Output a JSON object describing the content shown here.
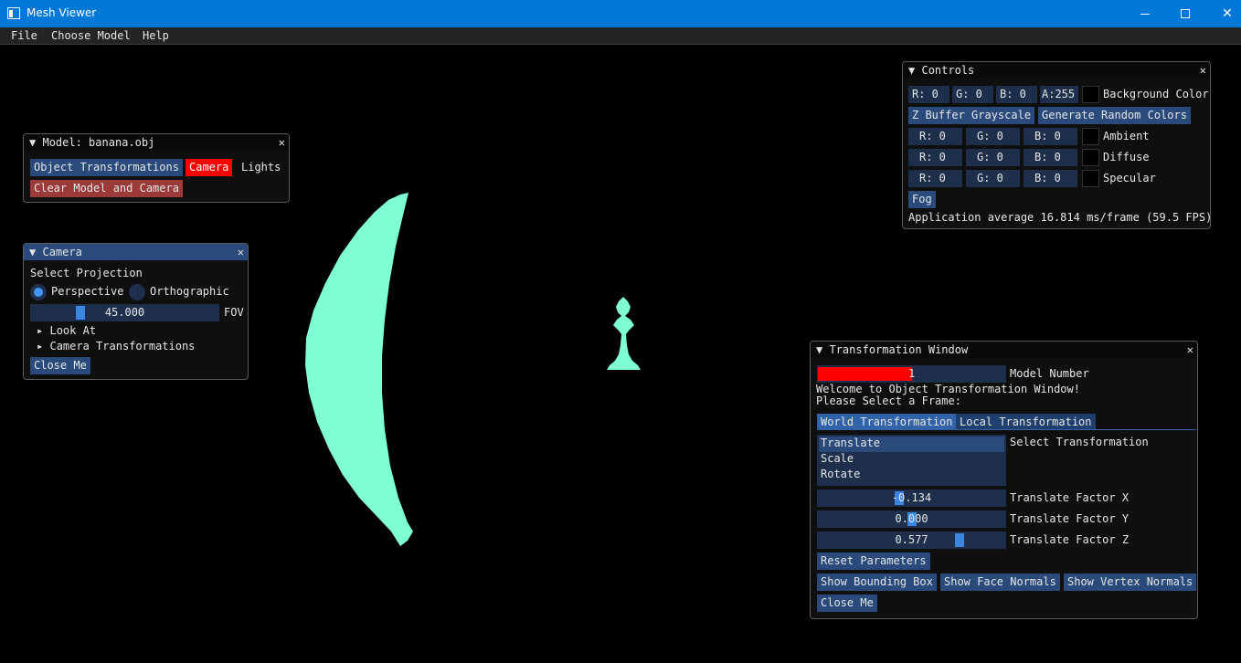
{
  "window": {
    "title": "Mesh Viewer",
    "minimize_icon": "minimize-icon",
    "maximize_icon": "maximize-icon",
    "close_glyph": "✕"
  },
  "menu": [
    "File",
    "Choose Model",
    "Help"
  ],
  "colors": {
    "titlebar": "#0078d7",
    "mesh": "#7fffd4",
    "imgui_button": "#294a7a",
    "imgui_frame": "#1d2f4a",
    "active_red": "#ff0000",
    "clear_button": "#9c3a3a",
    "slider_grab": "#3d85e0"
  },
  "model_window": {
    "title": "Model: banana.obj",
    "buttons": [
      "Object Transformations",
      "Camera",
      "Lights",
      "Clear Model and Camera"
    ]
  },
  "camera_window": {
    "title": "Camera",
    "select_projection": "Select Projection",
    "options": [
      "Perspective",
      "Orthographic"
    ],
    "selected": "Perspective",
    "fov_value": "45.000",
    "fov_fraction": 0.25,
    "fov_label": "FOV",
    "tree": [
      "Look At",
      "Camera Transformations"
    ],
    "close": "Close Me"
  },
  "controls_window": {
    "title": "Controls",
    "background": {
      "r": "R:  0",
      "g": "G:  0",
      "b": "B:  0",
      "a": "A:255",
      "label": "Background Color"
    },
    "zbuffer": "Z Buffer Grayscale",
    "random_colors": "Generate Random Colors",
    "rows": [
      {
        "r": "R:  0",
        "g": "G:  0",
        "b": "B:  0",
        "label": "Ambient"
      },
      {
        "r": "R:  0",
        "g": "G:  0",
        "b": "B:  0",
        "label": "Diffuse"
      },
      {
        "r": "R:  0",
        "g": "G:  0",
        "b": "B:  0",
        "label": "Specular"
      }
    ],
    "fog": "Fog",
    "fps": "Application average 16.814 ms/frame (59.5 FPS)"
  },
  "transform_window": {
    "title": "Transformation Window",
    "model_number_value": "1",
    "model_number_fraction": 0.5,
    "model_number_label": "Model Number",
    "welcome": "Welcome to Object Transformation Window!",
    "select_frame": "Please Select a Frame:",
    "tabs": [
      "World Transformation",
      "Local Transformation"
    ],
    "list": [
      "Translate",
      "Scale",
      "Rotate"
    ],
    "selected_list_item": "Translate",
    "select_transformation": "Select Transformation",
    "factors": [
      {
        "value": "-0.134",
        "label": "Translate Factor X",
        "fraction": 0.43
      },
      {
        "value": "0.000",
        "label": "Translate Factor Y",
        "fraction": 0.5
      },
      {
        "value": "0.577",
        "label": "Translate Factor Z",
        "fraction": 0.77
      }
    ],
    "reset": "Reset Parameters",
    "show_buttons": [
      "Show Bounding Box",
      "Show Face Normals",
      "Show Vertex Normals"
    ],
    "close": "Close Me"
  },
  "scene": {
    "meshes": [
      "banana-mesh",
      "chess-bishop-mesh"
    ]
  }
}
